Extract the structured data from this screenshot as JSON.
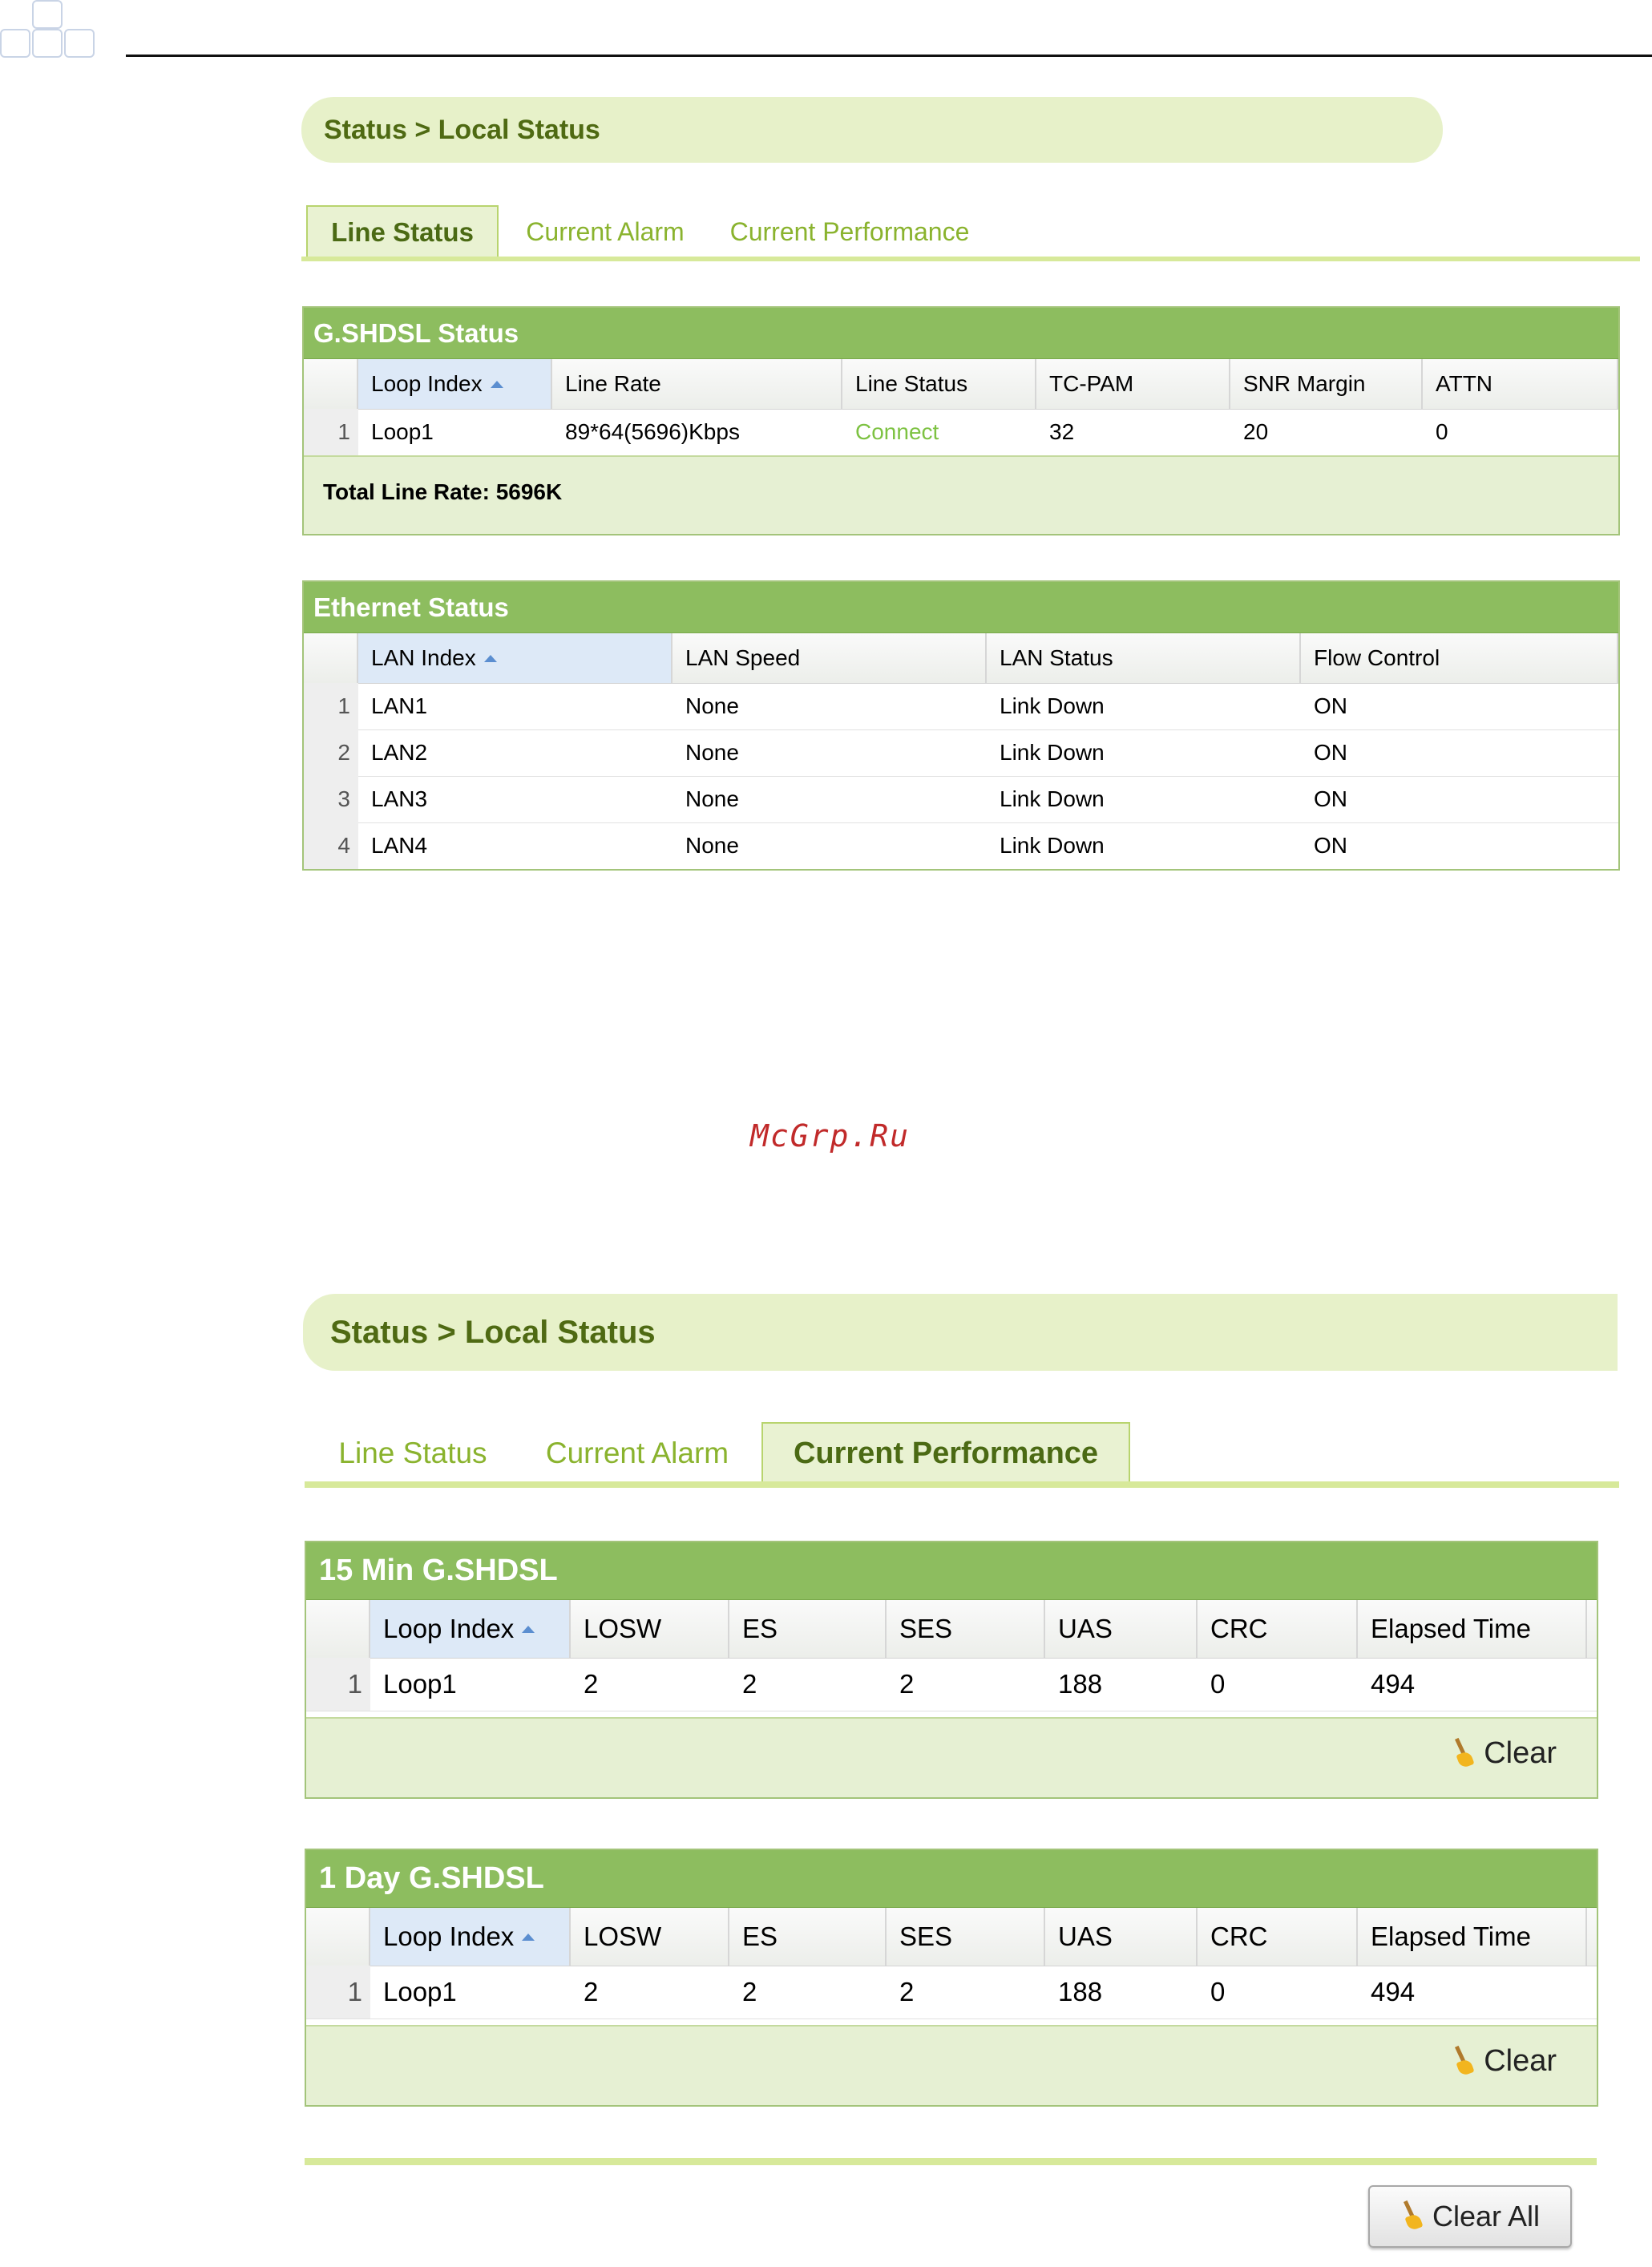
{
  "watermark": "McGrp.Ru",
  "screen1": {
    "breadcrumb": "Status > Local Status",
    "tabs": [
      {
        "label": "Line Status",
        "active": true
      },
      {
        "label": "Current Alarm",
        "active": false
      },
      {
        "label": "Current Performance",
        "active": false
      }
    ],
    "gshdsl": {
      "title": "G.SHDSL Status",
      "columns": [
        "Loop Index",
        "Line Rate",
        "Line Status",
        "TC-PAM",
        "SNR Margin",
        "ATTN"
      ],
      "rows": [
        {
          "num": "1",
          "cells": [
            "Loop1",
            "89*64(5696)Kbps",
            "Connect",
            "32",
            "20",
            "0"
          ]
        }
      ],
      "total": "Total Line Rate: 5696K"
    },
    "ethernet": {
      "title": "Ethernet Status",
      "columns": [
        "LAN Index",
        "LAN Speed",
        "LAN Status",
        "Flow Control"
      ],
      "rows": [
        {
          "num": "1",
          "cells": [
            "LAN1",
            "None",
            "Link Down",
            "ON"
          ]
        },
        {
          "num": "2",
          "cells": [
            "LAN2",
            "None",
            "Link Down",
            "ON"
          ]
        },
        {
          "num": "3",
          "cells": [
            "LAN3",
            "None",
            "Link Down",
            "ON"
          ]
        },
        {
          "num": "4",
          "cells": [
            "LAN4",
            "None",
            "Link Down",
            "ON"
          ]
        }
      ]
    }
  },
  "screen2": {
    "breadcrumb": "Status > Local Status",
    "tabs": [
      {
        "label": "Line Status",
        "active": false
      },
      {
        "label": "Current Alarm",
        "active": false
      },
      {
        "label": "Current Performance",
        "active": true
      }
    ],
    "min15": {
      "title": "15 Min G.SHDSL",
      "columns": [
        "Loop Index",
        "LOSW",
        "ES",
        "SES",
        "UAS",
        "CRC",
        "Elapsed Time"
      ],
      "rows": [
        {
          "num": "1",
          "cells": [
            "Loop1",
            "2",
            "2",
            "2",
            "188",
            "0",
            "494"
          ]
        }
      ],
      "clear_label": "Clear"
    },
    "day1": {
      "title": "1 Day G.SHDSL",
      "columns": [
        "Loop Index",
        "LOSW",
        "ES",
        "SES",
        "UAS",
        "CRC",
        "Elapsed Time"
      ],
      "rows": [
        {
          "num": "1",
          "cells": [
            "Loop1",
            "2",
            "2",
            "2",
            "188",
            "0",
            "494"
          ]
        }
      ],
      "clear_label": "Clear"
    },
    "clear_all_label": "Clear All"
  },
  "colors": {
    "connect": "#7dc242",
    "panel_header": "#8dbd5f",
    "breadcrumb_bg": "#e7f1c9"
  }
}
